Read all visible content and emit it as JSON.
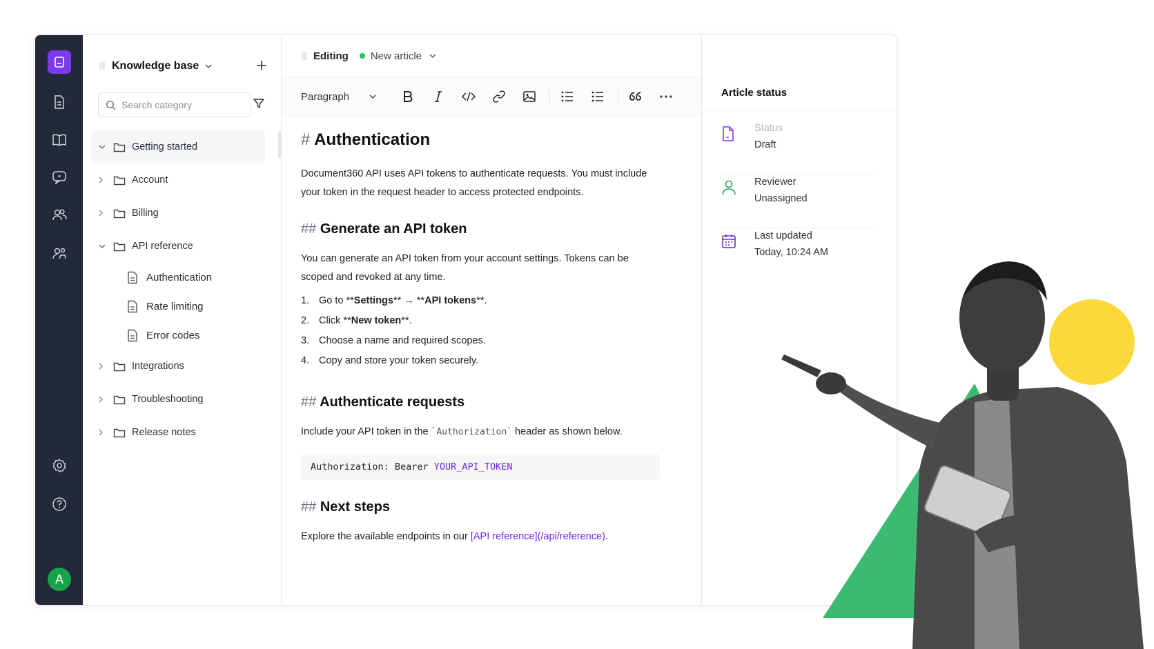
{
  "rail": {
    "items": [
      "articles",
      "knowledge-base",
      "feedback",
      "team",
      "users"
    ],
    "avatar_letter": "A"
  },
  "sidebar": {
    "title": "Knowledge base",
    "search_placeholder": "Search category",
    "tree": [
      {
        "label": "Getting started",
        "expanded": true,
        "active": true
      },
      {
        "label": "Account",
        "expanded": false
      },
      {
        "label": "Billing",
        "expanded": false
      },
      {
        "label": "API reference",
        "expanded": true,
        "children": [
          "Authentication",
          "Rate limiting",
          "Error codes"
        ]
      },
      {
        "label": "Integrations",
        "expanded": false
      },
      {
        "label": "Troubleshooting",
        "expanded": false
      },
      {
        "label": "Release notes",
        "expanded": false
      }
    ]
  },
  "editor": {
    "mode": "Editing",
    "article_name": "New article",
    "block_type": "Paragraph",
    "h1_mark": "#",
    "h2_mark": "##",
    "title": "Authentication",
    "intro": "Document360 API uses API tokens to authenticate requests. You must include your token in the request header to access protected endpoints.",
    "section1": {
      "heading": "Generate an API token",
      "text": "You can generate an API token from your account settings. Tokens can be scoped and revoked at any time.",
      "steps": [
        {
          "n": "1.",
          "a": "Go to **",
          "b": "Settings",
          "c": "** → **",
          "d": "API tokens",
          "e": "**."
        },
        {
          "n": "2.",
          "a": "Click **",
          "b": "New token",
          "c": "**."
        },
        {
          "n": "3.",
          "a": "Choose a name and required scopes."
        },
        {
          "n": "4.",
          "a": "Copy and store your token securely."
        }
      ]
    },
    "section2": {
      "heading": "Authenticate requests",
      "text_before": "Include your API token in the ",
      "inline_code": "`Authorization`",
      "text_after": " header as shown below.",
      "code_prefix": "Authorization: Bearer",
      "code_token": "YOUR_API_TOKEN"
    },
    "section3": {
      "heading": "Next steps",
      "text_before": "Explore the available endpoints in our ",
      "link": "[API reference](/api/reference)",
      "text_after": "."
    }
  },
  "status_panel": {
    "title": "Article status",
    "status_label": "Status",
    "status_value": "Draft",
    "reviewer_label": "Reviewer",
    "reviewer_value": "Unassigned",
    "updated_label": "Last updated",
    "updated_value": "Today, 10:24 AM"
  },
  "colors": {
    "accent": "#7c3aed",
    "rail_bg": "#24293a",
    "status_dot": "#22c55e",
    "deco_yellow": "#fcd93a",
    "deco_green": "#3dba72"
  }
}
